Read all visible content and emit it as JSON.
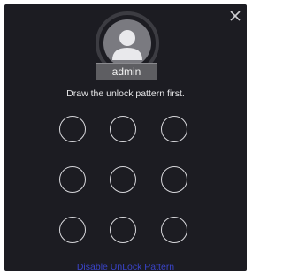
{
  "dialog": {
    "close_icon": "close-icon",
    "user": {
      "avatar_icon": "user-avatar-icon",
      "name": "admin"
    },
    "hint": "Draw the unlock pattern first.",
    "pattern": {
      "rows": 3,
      "cols": 3
    },
    "disable_link": "Disable UnLock Pattern"
  },
  "colors": {
    "background": "#1c1c22",
    "link": "#3a44c8",
    "circle_stroke": "#d8d8dc"
  }
}
